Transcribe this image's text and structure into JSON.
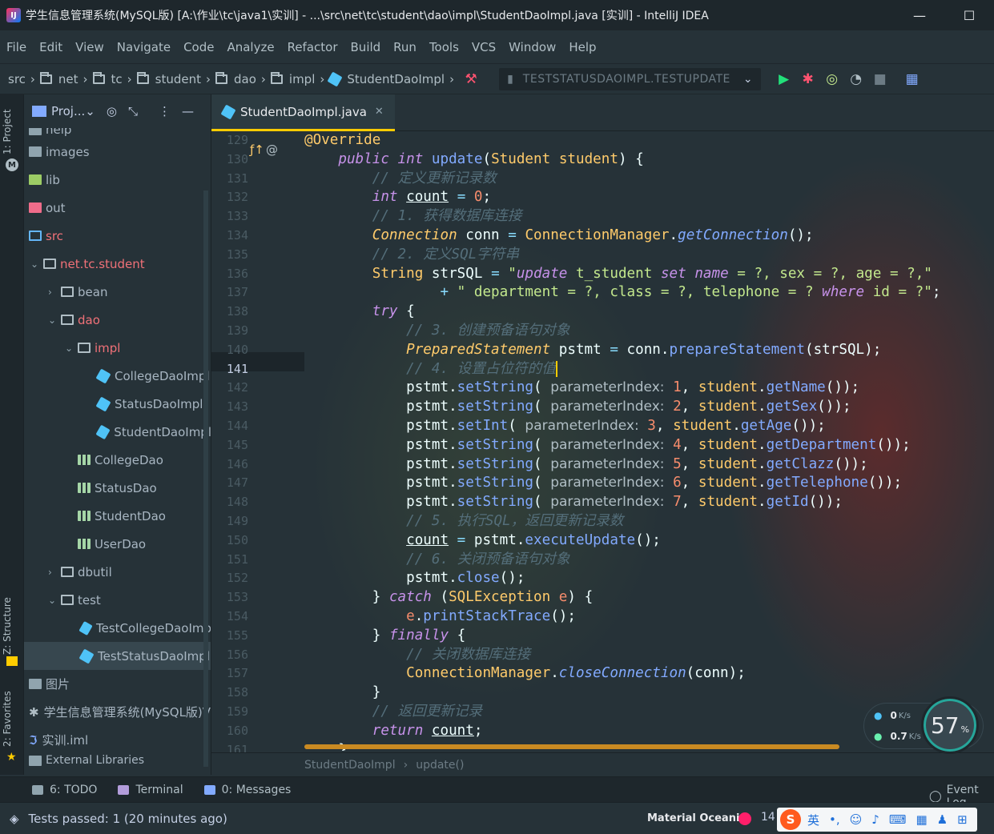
{
  "window": {
    "title": "学生信息管理系统(MySQL版) [A:\\作业\\tc\\java1\\实训] - ...\\src\\net\\tc\\student\\dao\\impl\\StudentDaoImpl.java [实训] - IntelliJ IDEA",
    "minimize": "—",
    "maximize": "☐"
  },
  "menu": [
    "File",
    "Edit",
    "View",
    "Navigate",
    "Code",
    "Analyze",
    "Refactor",
    "Build",
    "Run",
    "Tools",
    "VCS",
    "Window",
    "Help"
  ],
  "breadcrumbs": [
    "src",
    "net",
    "tc",
    "student",
    "dao",
    "impl",
    "StudentDaoImpl"
  ],
  "run_config": "TESTSTATUSDAOIMPL.TESTUPDATE",
  "left_tabs": {
    "project": "1: Project",
    "structure": "Z: Structure",
    "favorites": "2: Favorites"
  },
  "project_panel": {
    "title": "Proj...",
    "tree": [
      {
        "label": "help",
        "icon": "folder"
      },
      {
        "label": "images",
        "icon": "folder"
      },
      {
        "label": "lib",
        "icon": "folder"
      },
      {
        "label": "out",
        "icon": "folder"
      },
      {
        "label": "src",
        "icon": "folder"
      },
      {
        "label": "net.tc.student",
        "icon": "package"
      },
      {
        "label": "bean",
        "icon": "package"
      },
      {
        "label": "dao",
        "icon": "package"
      },
      {
        "label": "impl",
        "icon": "package"
      },
      {
        "label": "CollegeDaoImpl",
        "icon": "class"
      },
      {
        "label": "StatusDaoImpl",
        "icon": "class"
      },
      {
        "label": "StudentDaoImpl",
        "icon": "class"
      },
      {
        "label": "CollegeDao",
        "icon": "interface"
      },
      {
        "label": "StatusDao",
        "icon": "interface"
      },
      {
        "label": "StudentDao",
        "icon": "interface"
      },
      {
        "label": "UserDao",
        "icon": "interface"
      },
      {
        "label": "dbutil",
        "icon": "package"
      },
      {
        "label": "test",
        "icon": "package"
      },
      {
        "label": "TestCollegeDaoImp",
        "icon": "test-class"
      },
      {
        "label": "TestStatusDaoImpl",
        "icon": "test-class"
      },
      {
        "label": "图片",
        "icon": "folder"
      },
      {
        "label": "学生信息管理系统(MySQL版)V",
        "icon": "file"
      },
      {
        "label": "实训.iml",
        "icon": "iml"
      },
      {
        "label": "External Libraries",
        "icon": "library"
      }
    ]
  },
  "editor": {
    "tab": "StudentDaoImpl.java",
    "first_line": 129,
    "current_line": 141,
    "line_numbers": [
      "129",
      "130",
      "131",
      "132",
      "133",
      "134",
      "135",
      "136",
      "137",
      "138",
      "139",
      "140",
      "141",
      "142",
      "143",
      "144",
      "145",
      "146",
      "147",
      "148",
      "149",
      "150",
      "151",
      "152",
      "153",
      "154",
      "155",
      "156",
      "157",
      "158",
      "159",
      "160",
      "161"
    ],
    "crumbs": [
      "StudentDaoImpl",
      "update()"
    ]
  },
  "bottom_tools": [
    "6: TODO",
    "Terminal",
    "0: Messages"
  ],
  "event_log": "Event Log",
  "status": {
    "message": "Tests passed: 1 (20 minutes ago)",
    "theme": "Material Oceanic",
    "position": "14",
    "ime": "英"
  },
  "net_widget": {
    "up": "0",
    "up_unit": "K/s",
    "down": "0.7",
    "down_unit": "K/s",
    "gauge": "57",
    "gauge_unit": "%"
  },
  "colors": {
    "background": "#263238",
    "accent": "#ffcc00",
    "keyword": "#c792ea",
    "type": "#ffcb6b",
    "function": "#82aaff",
    "comment": "#546e7a",
    "string": "#c3e88d",
    "number": "#f78c6c"
  }
}
